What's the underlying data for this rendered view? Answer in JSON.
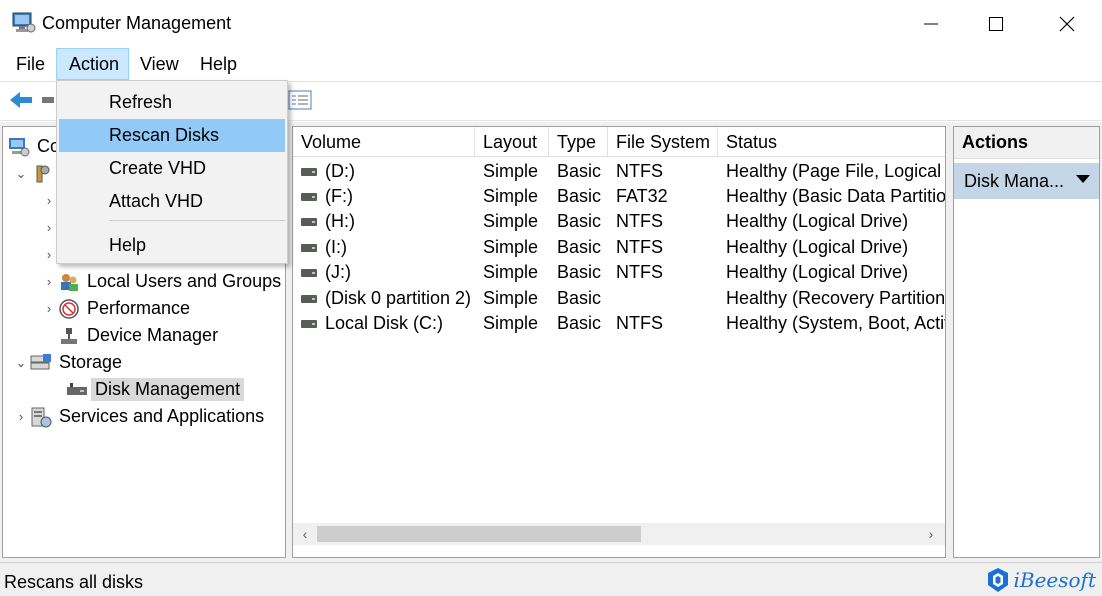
{
  "window": {
    "title": "Computer Management"
  },
  "menubar": {
    "items": [
      "File",
      "Action",
      "View",
      "Help"
    ]
  },
  "action_menu": {
    "items": [
      "Refresh",
      "Rescan Disks",
      "Create VHD",
      "Attach VHD",
      "Help"
    ],
    "highlighted": "Rescan Disks"
  },
  "tree": {
    "root_label": "Co",
    "items": [
      "Local Users and Groups",
      "Performance",
      "Device Manager",
      "Storage",
      "Disk Management",
      "Services and Applications"
    ],
    "selected": "Disk Management"
  },
  "volumes": {
    "columns": [
      "Volume",
      "Layout",
      "Type",
      "File System",
      "Status"
    ],
    "rows": [
      [
        "(D:)",
        "Simple",
        "Basic",
        "NTFS",
        "Healthy (Page File, Logical D"
      ],
      [
        "(F:)",
        "Simple",
        "Basic",
        "FAT32",
        "Healthy (Basic Data Partition"
      ],
      [
        "(H:)",
        "Simple",
        "Basic",
        "NTFS",
        "Healthy (Logical Drive)"
      ],
      [
        "(I:)",
        "Simple",
        "Basic",
        "NTFS",
        "Healthy (Logical Drive)"
      ],
      [
        "(J:)",
        "Simple",
        "Basic",
        "NTFS",
        "Healthy (Logical Drive)"
      ],
      [
        "(Disk 0 partition 2)",
        "Simple",
        "Basic",
        "",
        "Healthy (Recovery Partition"
      ],
      [
        "Local Disk (C:)",
        "Simple",
        "Basic",
        "NTFS",
        "Healthy (System, Boot, Activ"
      ]
    ]
  },
  "actions": {
    "title": "Actions",
    "sub": "Disk Mana..."
  },
  "statusbar": {
    "text": "Rescans all disks"
  },
  "watermark": {
    "text": "iBeesoft"
  },
  "colors": {
    "menu_active_bg": "#cce8ff",
    "dropdown_highlight": "#91c9f7",
    "actions_sub_bg": "#c5d5e8",
    "watermark": "#1d6fd1"
  }
}
